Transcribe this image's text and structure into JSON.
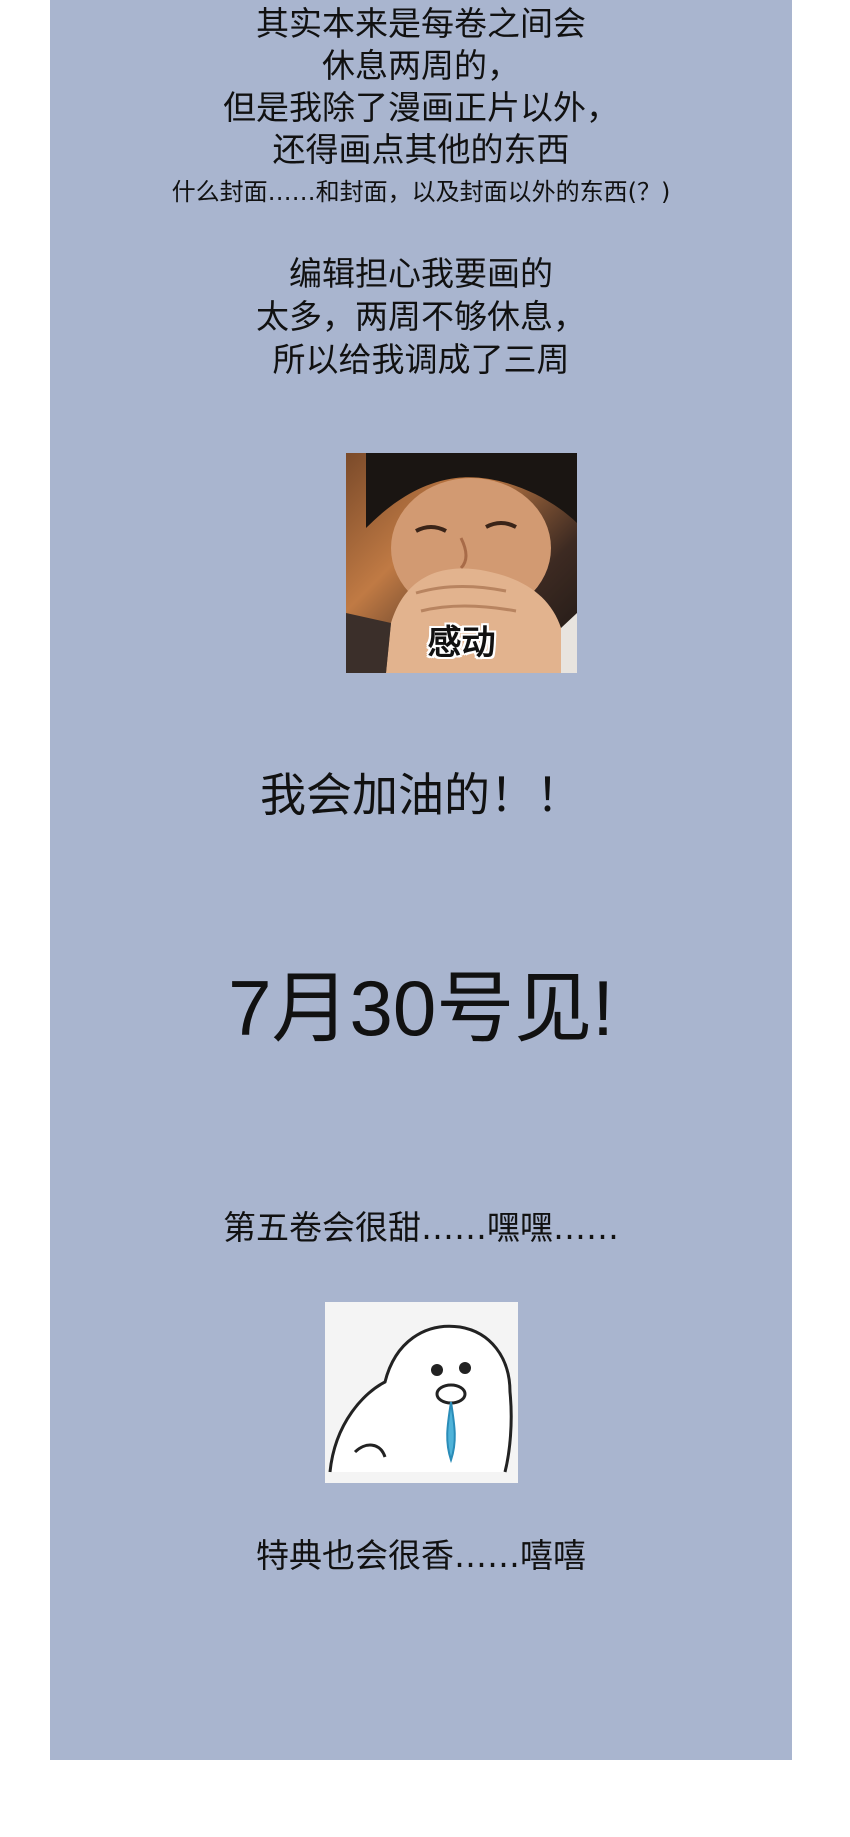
{
  "intro": {
    "lines": [
      "其实本来是每卷之间会",
      "休息两周的，",
      "但是我除了漫画正片以外，",
      "还得画点其他的东西"
    ],
    "small_line": "什么封面……和封面，以及封面以外的东西(？)"
  },
  "editor": {
    "lines": [
      "编辑担心我要画的",
      "太多，两周不够休息，",
      "所以给我调成了三周"
    ]
  },
  "meme1": {
    "caption": "感动"
  },
  "cheer": "我会加油的！！",
  "see_you": "7月30号见!",
  "volume5": "第五卷会很甜……嘿嘿……",
  "bonus": "特典也会很香……嘻嘻",
  "colors": {
    "panel": "#a9b5cf",
    "text": "#111111"
  }
}
